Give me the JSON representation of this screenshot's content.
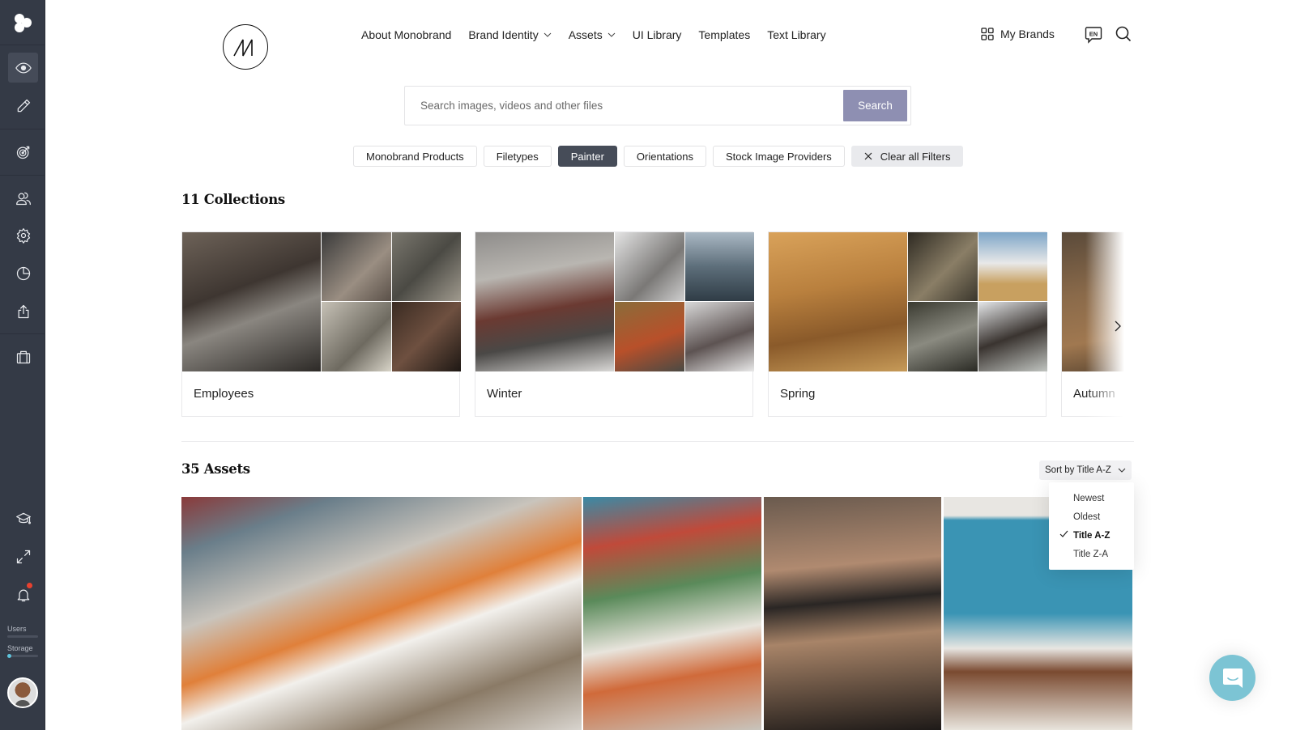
{
  "sidebar": {
    "logo_icon": "monobrand-app-logo-icon",
    "items": [
      {
        "name": "view",
        "icon": "eye-icon",
        "active": true
      },
      {
        "name": "edit",
        "icon": "pencil-icon",
        "active": false
      },
      {
        "name": "goals",
        "icon": "target-icon",
        "active": false
      },
      {
        "name": "users",
        "icon": "users-icon",
        "active": false
      },
      {
        "name": "settings",
        "icon": "gear-icon",
        "active": false
      },
      {
        "name": "analytics",
        "icon": "pie-chart-icon",
        "active": false
      },
      {
        "name": "share",
        "icon": "upload-icon",
        "active": false
      },
      {
        "name": "portfolio",
        "icon": "briefcase-icon",
        "active": false
      }
    ],
    "bottom_items": [
      {
        "name": "academy",
        "icon": "graduation-cap-icon"
      },
      {
        "name": "fullscreen",
        "icon": "expand-icon"
      },
      {
        "name": "notifications",
        "icon": "bell-icon",
        "has_badge": true
      }
    ],
    "meters": [
      {
        "label": "Users",
        "fraction": 0.0
      },
      {
        "label": "Storage",
        "fraction": 0.05
      }
    ],
    "accent_color": "#5ec4dc"
  },
  "header": {
    "logo": "monobrand-logo",
    "nav": [
      {
        "label": "About Monobrand",
        "dropdown": false
      },
      {
        "label": "Brand Identity",
        "dropdown": true
      },
      {
        "label": "Assets",
        "dropdown": true
      },
      {
        "label": "UI Library",
        "dropdown": false
      },
      {
        "label": "Templates",
        "dropdown": false
      },
      {
        "label": "Text Library",
        "dropdown": false
      }
    ],
    "my_brands_label": "My Brands",
    "language_code": "EN"
  },
  "search": {
    "placeholder": "Search images, videos and other files",
    "value": "",
    "button_label": "Search",
    "button_color": "#8e8fb2"
  },
  "filters": [
    {
      "label": "Monobrand Products",
      "active": false
    },
    {
      "label": "Filetypes",
      "active": false
    },
    {
      "label": "Painter",
      "active": true
    },
    {
      "label": "Orientations",
      "active": false
    },
    {
      "label": "Stock Image Providers",
      "active": false
    }
  ],
  "clear_filters_label": "Clear all Filters",
  "collections": {
    "title": "11 Collections",
    "items": [
      {
        "name": "Employees"
      },
      {
        "name": "Winter"
      },
      {
        "name": "Spring"
      },
      {
        "name": "Autumn"
      }
    ]
  },
  "assets": {
    "title": "35 Assets",
    "sort": {
      "label": "Sort by Title A-Z",
      "options": [
        "Newest",
        "Oldest",
        "Title A-Z",
        "Title Z-A"
      ],
      "selected": "Title A-Z"
    },
    "items": [
      {
        "description": "Painter studio with large orange abstract canvas"
      },
      {
        "description": "Studio with graffiti canvases and easels"
      },
      {
        "description": "Legs painted with black ink strokes"
      },
      {
        "description": "Person holding painted plate over blue background"
      }
    ]
  },
  "chat_widget": {
    "icon": "chat-bubble-icon",
    "color": "#7cc4d4"
  }
}
